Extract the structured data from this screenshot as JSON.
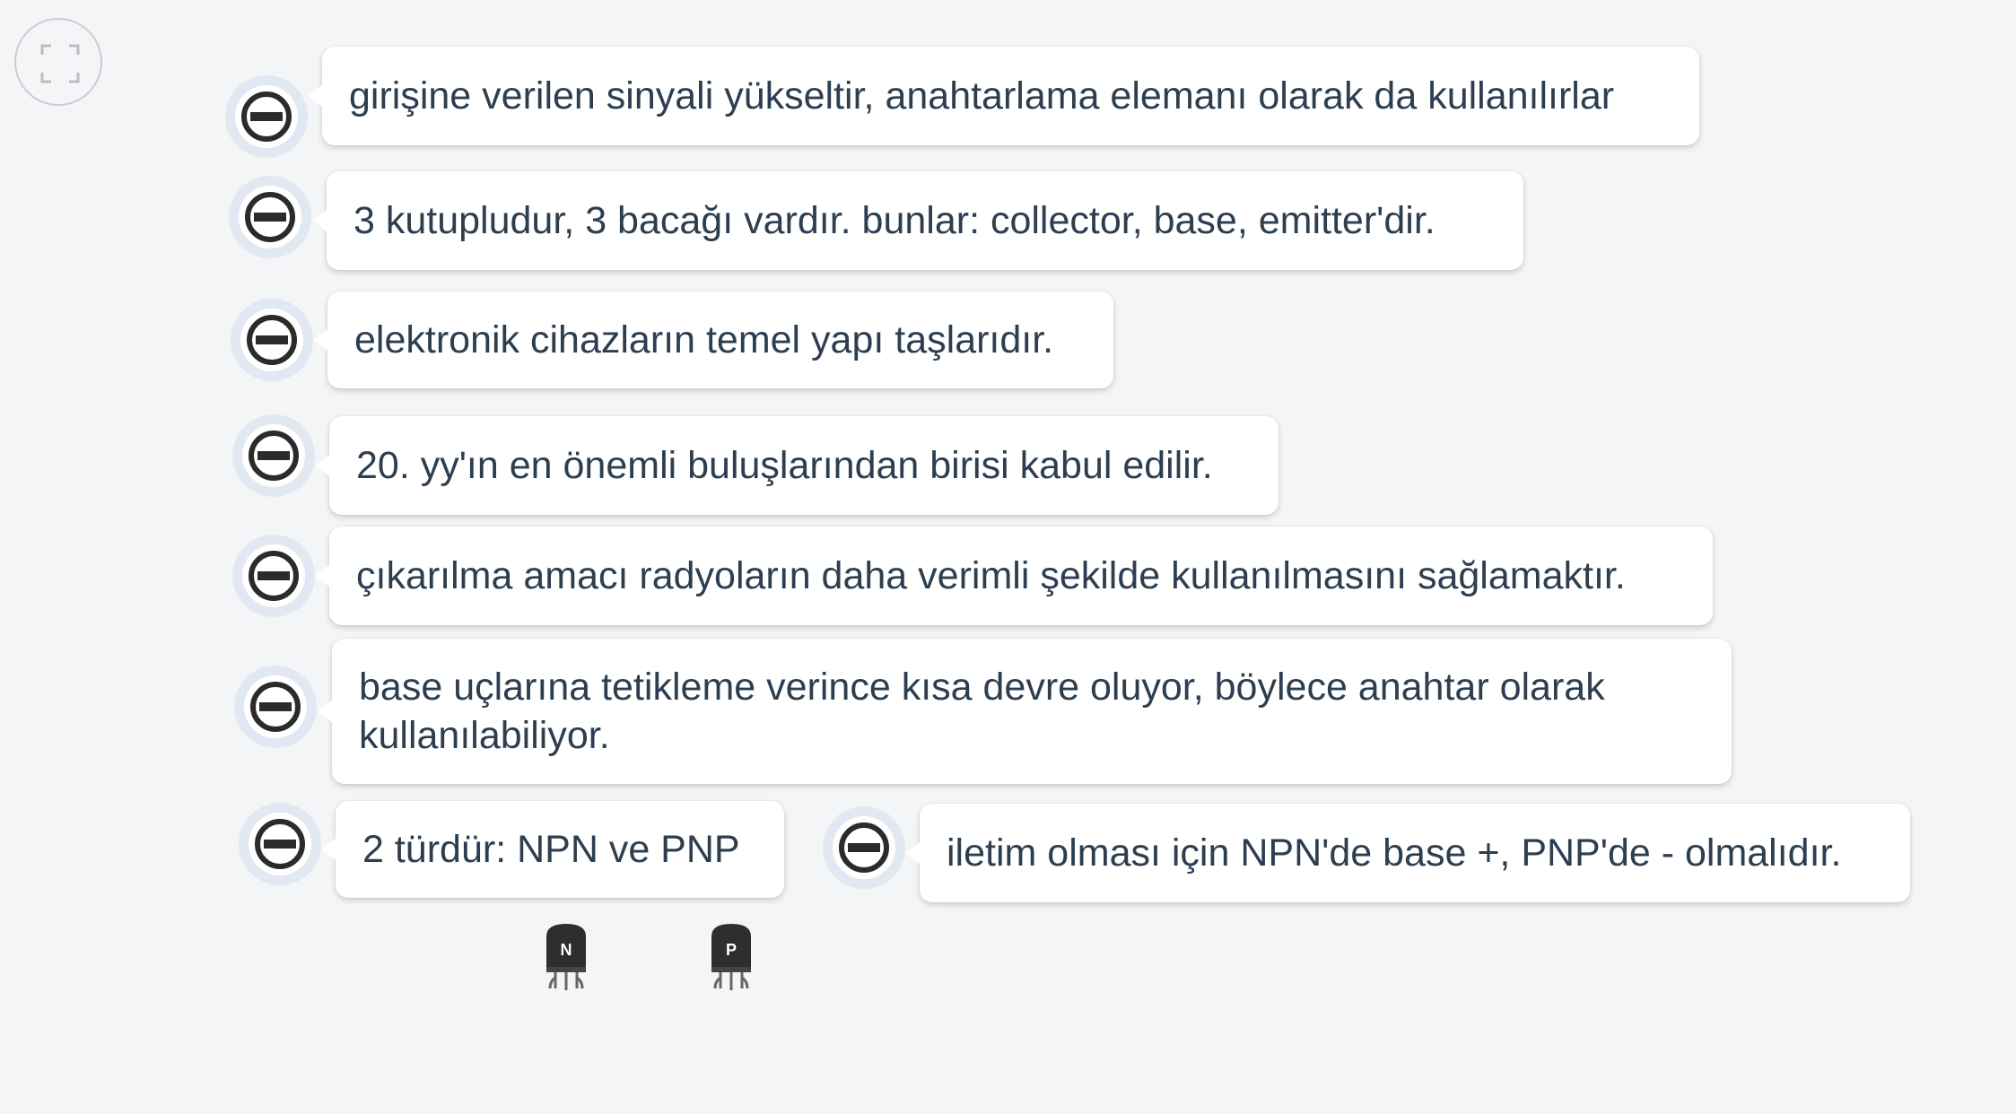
{
  "toolbar": {
    "fullscreen_icon": "expand-icon"
  },
  "nodes": [
    {
      "text": "girişine verilen sinyali yükseltir, anahtarlama elemanı olarak da kullanılırlar"
    },
    {
      "text": "3 kutupludur, 3 bacağı vardır. bunlar: collector, base, emitter'dir."
    },
    {
      "text": "elektronik cihazların temel yapı taşlarıdır."
    },
    {
      "text": "20. yy'ın en önemli buluşlarından birisi kabul edilir."
    },
    {
      "text": "çıkarılma amacı radyoların daha verimli şekilde kullanılmasını sağlamaktır."
    },
    {
      "text": "base uçlarına tetikleme verince kısa devre oluyor, böylece anahtar olarak kullanılabiliyor."
    },
    {
      "text": "2 türdür: NPN ve PNP"
    },
    {
      "text": "iletim olması için NPN'de base +, PNP'de - olmalıdır."
    }
  ],
  "transistors": [
    {
      "label": "N"
    },
    {
      "label": "P"
    }
  ],
  "colors": {
    "background": "#f4f5f7",
    "text": "#2c3e50",
    "icon": "#2b2b2b",
    "collapse_halo": "#e2e8f2"
  }
}
